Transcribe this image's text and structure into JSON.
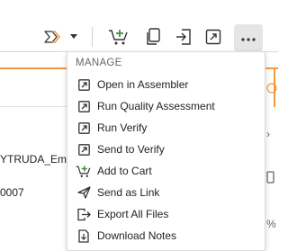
{
  "background": {
    "row1_text": "YTRUDA_Em",
    "row2_text": "0007",
    "right_symbol_1": "›",
    "right_symbol_2": "%"
  },
  "toolbar": {
    "icons": [
      "double-chevron-icon",
      "chevron-down-icon",
      "add-to-cart-icon",
      "copy-icon",
      "export-icon",
      "open-external-icon",
      "more-icon"
    ]
  },
  "menu": {
    "header": "MANAGE",
    "items": [
      {
        "label": "Open in Assembler",
        "icon": "open-external-icon"
      },
      {
        "label": "Run Quality Assessment",
        "icon": "open-external-icon"
      },
      {
        "label": "Run Verify",
        "icon": "open-external-icon"
      },
      {
        "label": "Send to Verify",
        "icon": "open-external-icon"
      },
      {
        "label": "Add to Cart",
        "icon": "add-to-cart-icon"
      },
      {
        "label": "Send as Link",
        "icon": "send-icon"
      },
      {
        "label": "Export All Files",
        "icon": "export-files-icon"
      },
      {
        "label": "Download Notes",
        "icon": "download-notes-icon"
      }
    ]
  },
  "colors": {
    "accent_orange": "#f29a3b",
    "cart_green": "#3f8f3a",
    "more_button_bg": "#e5e5e5"
  }
}
